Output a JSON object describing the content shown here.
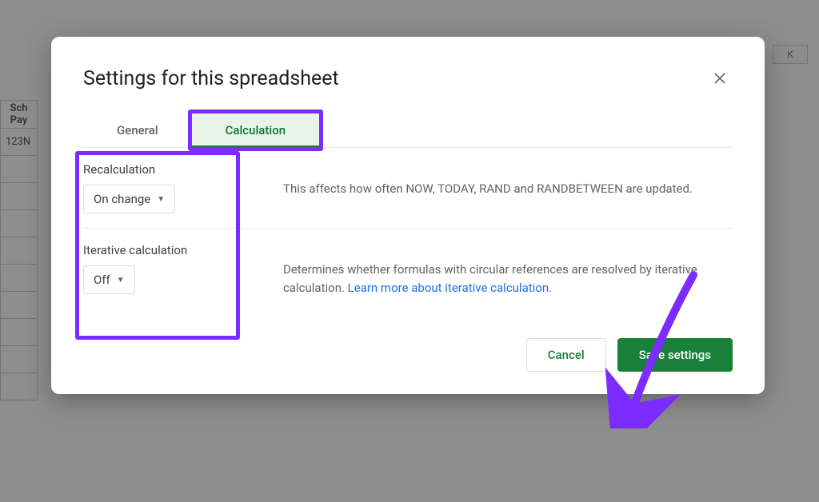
{
  "dialog": {
    "title": "Settings for this spreadsheet",
    "tabs": {
      "general": "General",
      "calculation": "Calculation"
    },
    "recalc": {
      "label": "Recalculation",
      "value": "On change",
      "desc": "This affects how often NOW, TODAY, RAND and RANDBETWEEN are updated."
    },
    "iterative": {
      "label": "Iterative calculation",
      "value": "Off",
      "desc_prefix": "Determines whether formulas with circular references are resolved by iterative calculation. ",
      "link_text": "Learn more about iterative calculation."
    },
    "buttons": {
      "cancel": "Cancel",
      "save": "Save settings"
    }
  },
  "background": {
    "col_k": "K",
    "header1": "Sch",
    "header2": "Pay",
    "cell": "123N"
  },
  "colors": {
    "highlight": "#7c2cff",
    "primary": "#188038"
  }
}
